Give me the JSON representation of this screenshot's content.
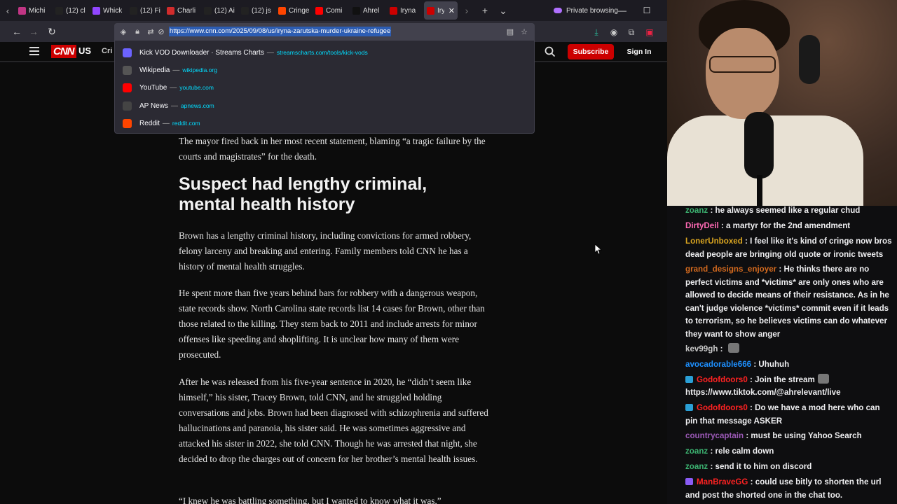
{
  "browser": {
    "tabs": [
      {
        "title": "Michi",
        "icon": "instagram-icon",
        "color": "#c13584",
        "active": false
      },
      {
        "title": "(12) cl",
        "icon": "x-icon",
        "color": "#222222",
        "active": false
      },
      {
        "title": "Whick",
        "icon": "twitch-icon",
        "color": "#9146ff",
        "active": false
      },
      {
        "title": "(12) Fi",
        "icon": "x-icon",
        "color": "#222222",
        "active": false
      },
      {
        "title": "Charli",
        "icon": "pdf-icon",
        "color": "#d12c2c",
        "active": false
      },
      {
        "title": "(12) Ai",
        "icon": "x-icon",
        "color": "#222222",
        "active": false
      },
      {
        "title": "(12) js",
        "icon": "x-icon",
        "color": "#222222",
        "active": false
      },
      {
        "title": "Cringe",
        "icon": "reddit-icon",
        "color": "#ff4500",
        "active": false
      },
      {
        "title": "Comi",
        "icon": "youtube-icon",
        "color": "#ff0000",
        "active": false
      },
      {
        "title": "Ahrel",
        "icon": "tiktok-icon",
        "color": "#111111",
        "active": false
      },
      {
        "title": "Iryna",
        "icon": "cnn-icon",
        "color": "#cc0000",
        "active": false
      },
      {
        "title": "Iry",
        "icon": "cnn-icon",
        "color": "#cc0000",
        "active": true
      }
    ],
    "private_label": "Private browsing",
    "url": "https://www.cnn.com/2025/09/08/us/iryna-zarutska-murder-ukraine-refugee",
    "suggestions": [
      {
        "title": "Kick VOD Downloader · Streams Charts",
        "url": "streamscharts.com/tools/kick-vods",
        "icon": "streamscharts-icon",
        "color": "#6c63ff"
      },
      {
        "title": "Wikipedia",
        "url": "wikipedia.org",
        "icon": "wikipedia-icon",
        "color": "#555555"
      },
      {
        "title": "YouTube",
        "url": "youtube.com",
        "icon": "youtube-icon",
        "color": "#ff0000"
      },
      {
        "title": "AP News",
        "url": "apnews.com",
        "icon": "apnews-icon",
        "color": "#444444"
      },
      {
        "title": "Reddit",
        "url": "reddit.com",
        "icon": "reddit-icon",
        "color": "#ff4500"
      }
    ]
  },
  "cnn": {
    "logo": "CNN",
    "edition": "US",
    "nav_peek": "Cri",
    "subscribe_label": "Subscribe",
    "signin_label": "Sign In",
    "paragraphs": [
      "The mayor fired back in her most recent statement, blaming “a tragic failure by the courts and magistrates” for the death.",
      "Brown has a lengthy criminal history, including convictions for armed robbery, felony larceny and breaking and entering. Family members told CNN he has a history of mental health struggles.",
      "He spent more than five years behind bars for robbery with a dangerous weapon, state records show. North Carolina state records list 14 cases for Brown, other than those related to the killing. They stem back to 2011 and include arrests for minor offenses like speeding and shoplifting. It is unclear how many of them were prosecuted.",
      "After he was released from his five-year sentence in 2020, he “didn’t seem like himself,” his sister, Tracey Brown, told CNN, and he struggled holding conversations and jobs. Brown had been diagnosed with schizophrenia and suffered hallucinations and paranoia, his sister said. He was sometimes aggressive and attacked his sister in 2022, she told CNN. Though he was arrested that night, she decided to drop the charges out of concern for her brother’s mental health issues.",
      "“I knew he was battling something, but I wanted to know what it was,”"
    ],
    "headline": "Suspect had lengthy criminal, mental health history"
  },
  "chat": {
    "messages": [
      {
        "user": "zoanz",
        "color": "#3cb371",
        "text": "he always seemed like a regular chud",
        "badge": false
      },
      {
        "user": "DirtyDeil",
        "color": "#ff69b4",
        "text": "a martyr for the 2nd amendment",
        "badge": false
      },
      {
        "user": "LonerUnboxed",
        "color": "#daa520",
        "text": "I feel like it's kind of cringe now bros dead people are bringing old quote or ironic tweets",
        "badge": false
      },
      {
        "user": "grand_designs_enjoyer",
        "color": "#d2691e",
        "text": "He thinks there are no perfect victims and *victims* are only ones who are allowed to decide means of their resistance. As in he can't judge violence *victims* commit even if it leads to terrorism, so he believes victims can do whatever they want to show anger",
        "badge": false
      },
      {
        "user": "kev99gh",
        "color": "#c8c8c8",
        "text": "",
        "badge": false,
        "emote": "cat-emote"
      },
      {
        "user": "avocadorable666",
        "color": "#1e90ff",
        "text": "Uhuhuh",
        "badge": false
      },
      {
        "user": "Godofdoors0",
        "color": "#ff2222",
        "text": "Join the stream",
        "badge": true,
        "badge_color": "#2a9fd6",
        "emote": "hand-emote"
      },
      {
        "user": "",
        "color": "#efeff1",
        "text": "https://www.tiktok.com/@ahrelevant/live",
        "badge": false
      },
      {
        "user": "Godofdoors0",
        "color": "#ff2222",
        "text": "Do we have a mod here who can pin that message ASKER",
        "badge": true,
        "badge_color": "#2a9fd6"
      },
      {
        "user": "countrycaptain",
        "color": "#9b59b6",
        "text": "must be using Yahoo Search",
        "badge": false
      },
      {
        "user": "zoanz",
        "color": "#3cb371",
        "text": "rele calm down",
        "badge": false
      },
      {
        "user": "zoanz",
        "color": "#3cb371",
        "text": "send it to him on discord",
        "badge": false
      },
      {
        "user": "ManBraveGG",
        "color": "#ff2222",
        "text": "could use bitly to shorten the url and post the shorted one in the chat too.",
        "badge": true,
        "badge_color": "#8a5cf5"
      }
    ]
  }
}
